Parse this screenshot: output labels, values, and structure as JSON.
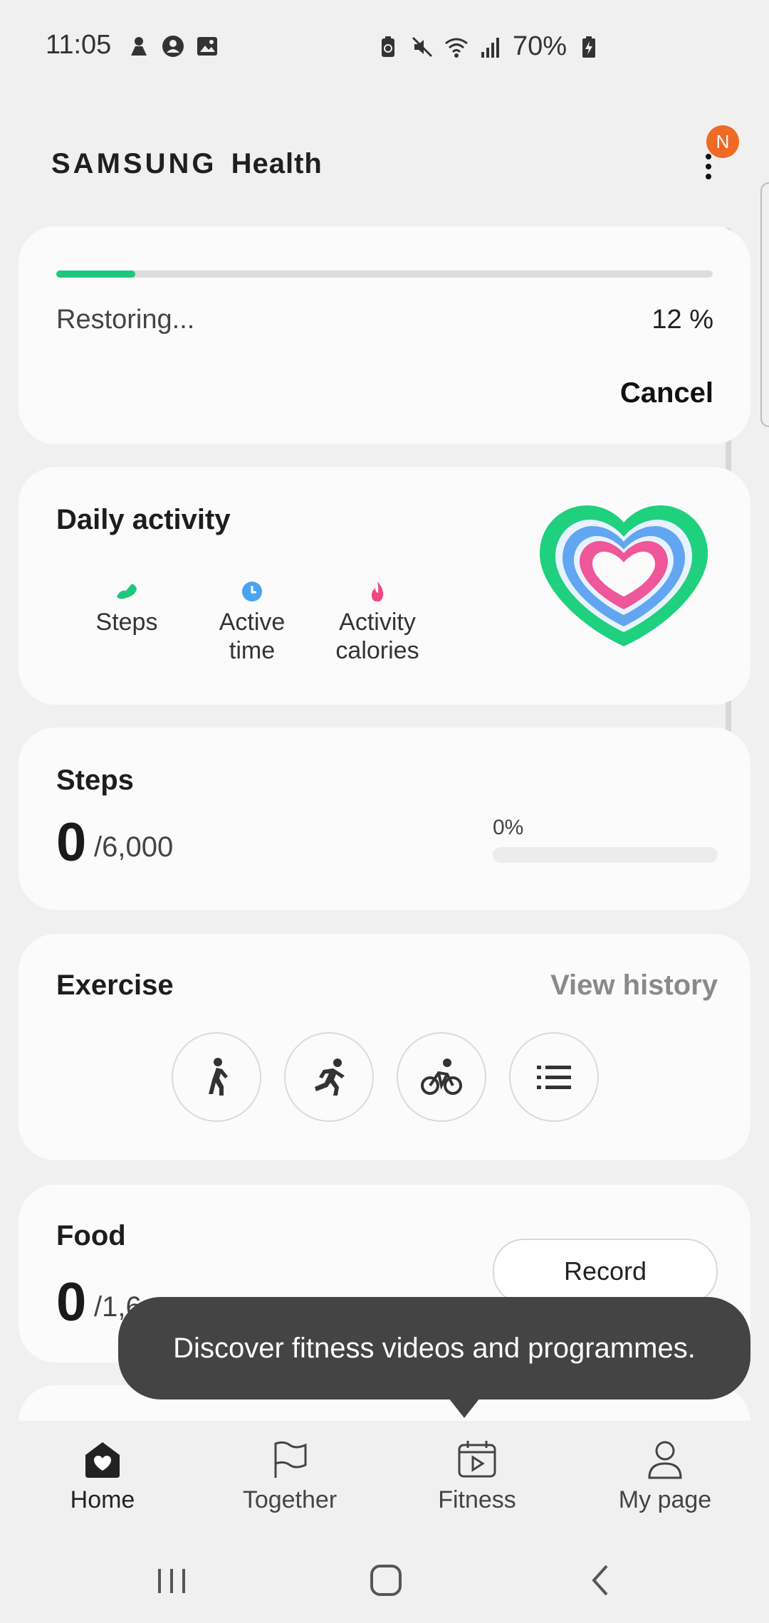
{
  "status_bar": {
    "time": "11:05",
    "battery_pct": "70%",
    "icons_left": [
      "app-notification-icon",
      "account-icon",
      "gallery-icon"
    ],
    "icons_right": [
      "battery-saver-icon",
      "mute-icon",
      "wifi-icon",
      "signal-icon",
      "battery-icon"
    ]
  },
  "header": {
    "brand_word1": "SAMSUNG",
    "brand_word2": "Health",
    "notification_badge": "N",
    "badge_color": "#f06a23"
  },
  "restore": {
    "label": "Restoring...",
    "percent_text": "12 %",
    "progress": 0.12,
    "cancel_label": "Cancel",
    "bar_color": "#1fc77e"
  },
  "daily_activity": {
    "title": "Daily activity",
    "items": [
      {
        "line1": "Steps",
        "line2": "",
        "icon": "shoe-icon",
        "color": "#1fc77e"
      },
      {
        "line1": "Active",
        "line2": "time",
        "icon": "clock-icon",
        "color": "#4aa3f0"
      },
      {
        "line1": "Activity",
        "line2": "calories",
        "icon": "flame-icon",
        "color": "#f0487f"
      }
    ]
  },
  "steps": {
    "title": "Steps",
    "count": "0",
    "goal": "/6,000",
    "percent": "0%"
  },
  "exercise": {
    "title": "Exercise",
    "view_history": "View history",
    "buttons": [
      "walking-icon",
      "running-icon",
      "cycling-icon",
      "list-icon"
    ]
  },
  "food": {
    "title": "Food",
    "count": "0",
    "goal": "/1,6",
    "record_label": "Record"
  },
  "tooltip": {
    "text": "Discover fitness videos and programmes."
  },
  "bottom_nav": {
    "items": [
      {
        "label": "Home",
        "icon": "home-icon",
        "active": true
      },
      {
        "label": "Together",
        "icon": "flag-icon",
        "active": false
      },
      {
        "label": "Fitness",
        "icon": "calendar-play-icon",
        "active": false
      },
      {
        "label": "My page",
        "icon": "person-icon",
        "active": false
      }
    ]
  }
}
